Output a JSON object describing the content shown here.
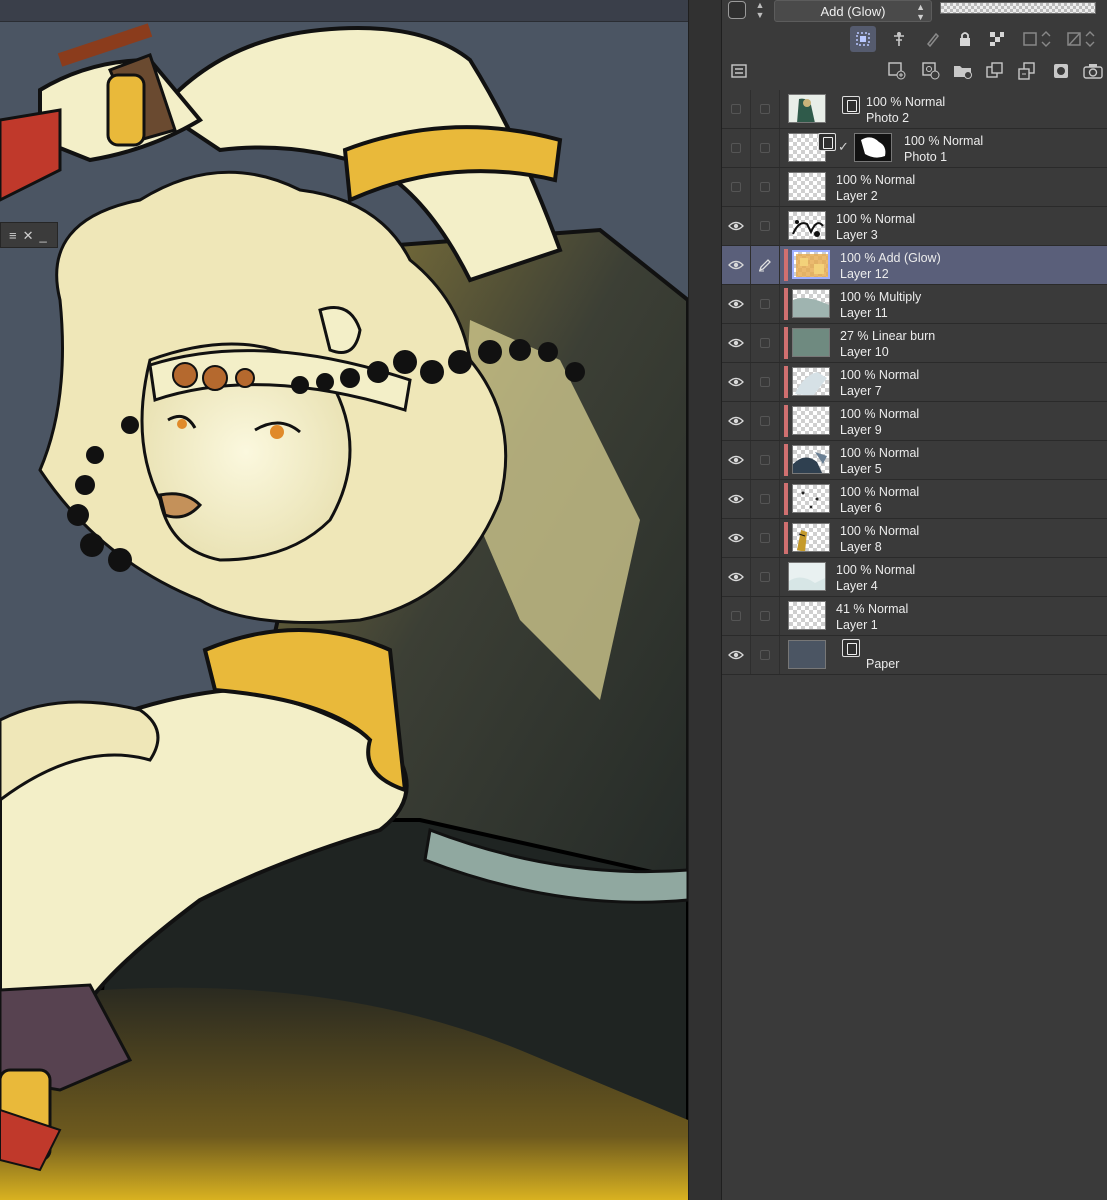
{
  "properties": {
    "blend_mode": "Add (Glow)"
  },
  "toolbar": {
    "row1_icons": [
      "clip-to-layer-below-icon",
      "reference-layer-icon",
      "draft-layer-icon",
      "lock-icon",
      "lock-transparency-icon",
      "mask-enable-icon",
      "mask-disable-icon"
    ],
    "row2_icons": [
      "layer-panel-menu-icon",
      "new-raster-layer-icon",
      "new-vector-layer-icon",
      "new-folder-icon",
      "copy-layer-icon",
      "merge-layer-icon",
      "layer-mask-icon",
      "camera-icon"
    ]
  },
  "floating_palette": {
    "menu": "≡",
    "close": "✕",
    "minimize": "_"
  },
  "layers": [
    {
      "opacity_mode": "100 %  Normal",
      "name": "Photo 2",
      "visible": false,
      "selected": false,
      "clipped": false,
      "thumb": "photo",
      "kind": "image"
    },
    {
      "opacity_mode": "100 %  Normal",
      "name": "Photo 1",
      "visible": false,
      "selected": false,
      "clipped": false,
      "thumb": "checker",
      "kind": "image-mask"
    },
    {
      "opacity_mode": "100 %  Normal",
      "name": "Layer 2",
      "visible": false,
      "selected": false,
      "clipped": false,
      "thumb": "checker"
    },
    {
      "opacity_mode": "100 %  Normal",
      "name": "Layer 3",
      "visible": true,
      "selected": false,
      "clipped": false,
      "thumb": "ink"
    },
    {
      "opacity_mode": "100 %  Add (Glow)",
      "name": "Layer 12",
      "visible": true,
      "selected": true,
      "clipped": true,
      "thumb": "glow"
    },
    {
      "opacity_mode": "100 %  Multiply",
      "name": "Layer 11",
      "visible": true,
      "selected": false,
      "clipped": true,
      "thumb": "multiply"
    },
    {
      "opacity_mode": "27 %  Linear burn",
      "name": "Layer 10",
      "visible": true,
      "selected": false,
      "clipped": true,
      "thumb": "teal"
    },
    {
      "opacity_mode": "100 %  Normal",
      "name": "Layer 7",
      "visible": true,
      "selected": false,
      "clipped": true,
      "thumb": "light"
    },
    {
      "opacity_mode": "100 %  Normal",
      "name": "Layer 9",
      "visible": true,
      "selected": false,
      "clipped": true,
      "thumb": "checker"
    },
    {
      "opacity_mode": "100 %  Normal",
      "name": "Layer 5",
      "visible": true,
      "selected": false,
      "clipped": true,
      "thumb": "dark"
    },
    {
      "opacity_mode": "100 %  Normal",
      "name": "Layer 6",
      "visible": true,
      "selected": false,
      "clipped": true,
      "thumb": "specks"
    },
    {
      "opacity_mode": "100 %  Normal",
      "name": "Layer 8",
      "visible": true,
      "selected": false,
      "clipped": true,
      "thumb": "gold"
    },
    {
      "opacity_mode": "100 %  Normal",
      "name": "Layer 4",
      "visible": true,
      "selected": false,
      "clipped": false,
      "thumb": "pale"
    },
    {
      "opacity_mode": "41 %  Normal",
      "name": "Layer 1",
      "visible": false,
      "selected": false,
      "clipped": false,
      "thumb": "checker"
    },
    {
      "opacity_mode": "",
      "name": "Paper",
      "visible": true,
      "selected": false,
      "clipped": false,
      "thumb": "paper",
      "kind": "paper"
    }
  ],
  "colors": {
    "canvas_bg": "#4b5563",
    "panel_bg": "#3a3a3a",
    "selected_row": "#5a5f7a",
    "clip_indicator": "#d07070",
    "fur": "#f3efc8",
    "gold": "#e9b93a",
    "vest": "#2f3532"
  }
}
